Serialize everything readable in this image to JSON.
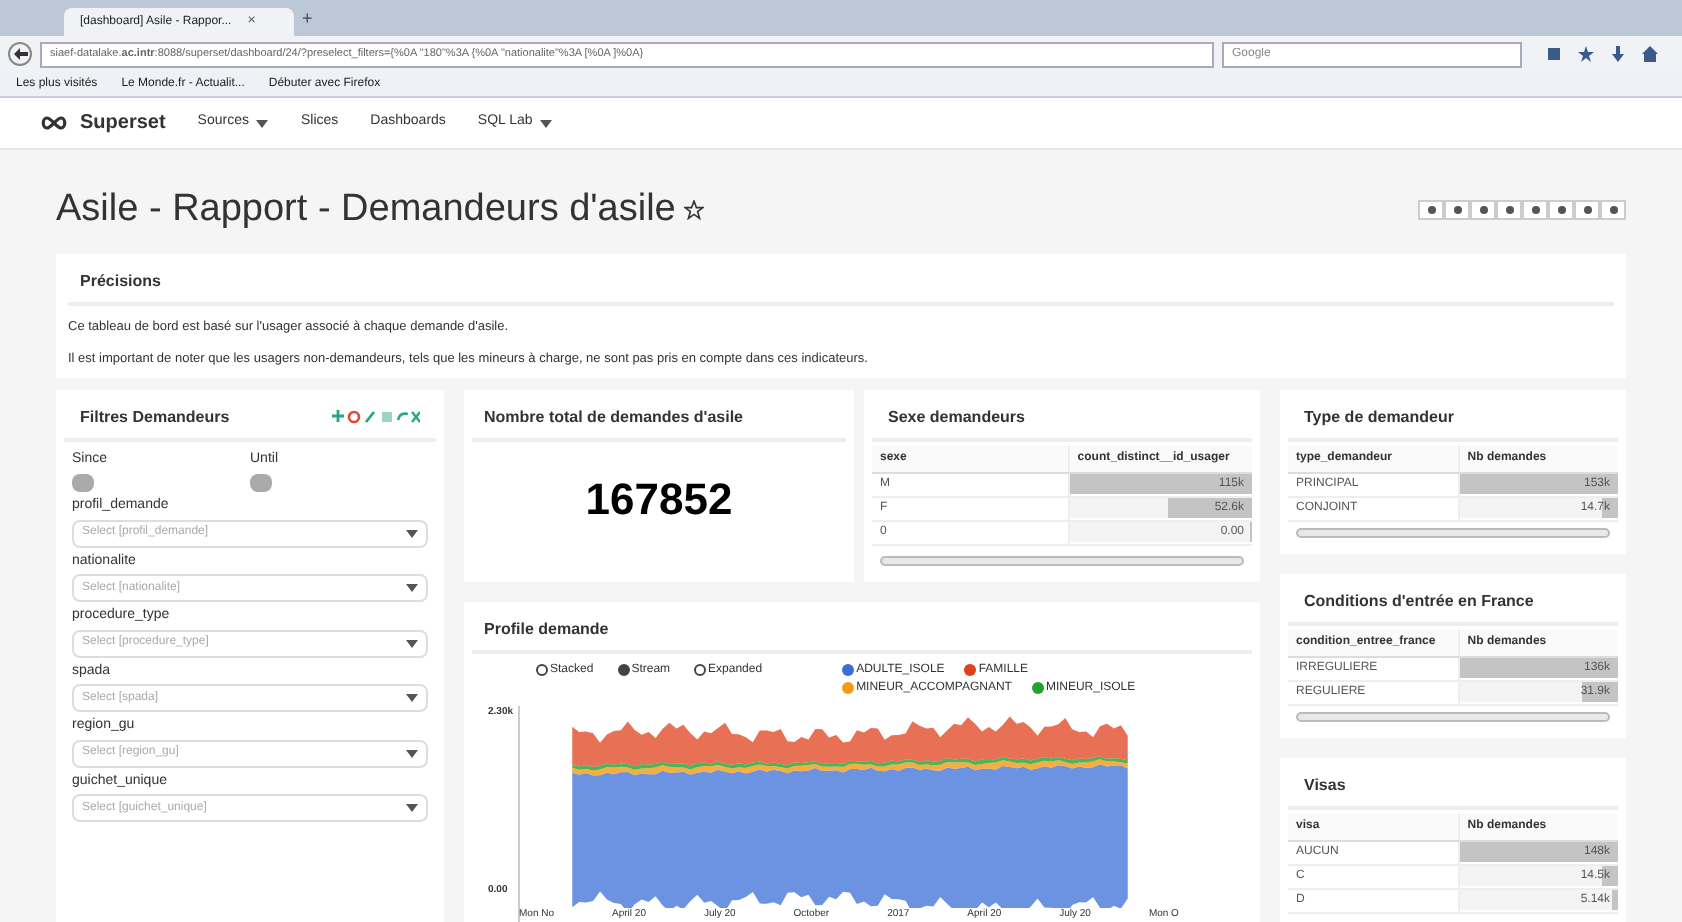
{
  "browser": {
    "tab": {
      "title": "[dashboard] Asile - Rappor...",
      "close": "×"
    },
    "new_tab": "+",
    "address": "siaef-datalake.**ac.intr**:8088/superset/dashboard/24/?preselect_filters={%0A  \"180\"%3A {%0A  \"nationalite\"%3A [%0A  ]%0A}",
    "search_placeholder": "Google",
    "bookmarks": [
      "Les plus visités",
      "Le Monde.fr - Actualit...",
      "Débuter avec Firefox"
    ]
  },
  "navbar": {
    "brand": "Superset",
    "items": [
      {
        "label": "Sources",
        "dropdown": true
      },
      {
        "label": "Slices",
        "dropdown": false
      },
      {
        "label": "Dashboards",
        "dropdown": false
      },
      {
        "label": "SQL Lab",
        "dropdown": true
      }
    ]
  },
  "dashboard": {
    "title": "Asile - Rapport - Demandeurs d'asile",
    "starred": false
  },
  "precisions": {
    "title": "Précisions",
    "lines": [
      "Ce tableau de bord est basé sur l'usager associé à chaque demande d'asile.",
      "Il est important de noter que les usagers non-demandeurs, tels que les mineurs à charge, ne sont pas pris en compte dans ces indicateurs."
    ]
  },
  "filters": {
    "title": "Filtres Demandeurs",
    "since": "Since",
    "until": "Until",
    "fields": [
      {
        "label": "profil_demande",
        "placeholder": "Select [profil_demande]"
      },
      {
        "label": "nationalite",
        "placeholder": "Select [nationalite]"
      },
      {
        "label": "procedure_type",
        "placeholder": "Select [procedure_type]"
      },
      {
        "label": "spada",
        "placeholder": "Select [spada]"
      },
      {
        "label": "region_gu",
        "placeholder": "Select [region_gu]"
      },
      {
        "label": "guichet_unique",
        "placeholder": "Select [guichet_unique]"
      }
    ]
  },
  "big_number": {
    "title": "Nombre total de demandes d'asile",
    "value": "167852"
  },
  "tables": [
    {
      "title": "Sexe demandeurs",
      "columns": [
        "sexe",
        "count_distinct__id_usager"
      ],
      "rows": [
        {
          "label": "M",
          "value": "115k",
          "level": 1
        },
        {
          "label": "F",
          "value": "52.6k",
          "level": 0.46
        },
        {
          "label": "0",
          "value": "0.00",
          "level": 0
        }
      ],
      "scrollbar": true
    },
    {
      "title": "Type de demandeur",
      "columns": [
        "type_demandeur",
        "Nb demandes"
      ],
      "rows": [
        {
          "label": "PRINCIPAL",
          "value": "153k",
          "level": 1
        },
        {
          "label": "CONJOINT",
          "value": "14.7k",
          "level": 0.1
        }
      ],
      "scrollbar": true
    },
    {
      "title": "Conditions d'entrée en France",
      "columns": [
        "condition_entree_france",
        "Nb demandes"
      ],
      "rows": [
        {
          "label": "IRREGULIERE",
          "value": "136k",
          "level": 1
        },
        {
          "label": "REGULIERE",
          "value": "31.9k",
          "level": 0.23
        }
      ],
      "scrollbar": true
    },
    {
      "title": "Visas",
      "columns": [
        "visa",
        "Nb demandes"
      ],
      "rows": [
        {
          "label": "AUCUN",
          "value": "148k",
          "level": 1
        },
        {
          "label": "C",
          "value": "14.5k",
          "level": 0.1
        },
        {
          "label": "D",
          "value": "5.14k",
          "level": 0.035
        }
      ],
      "scrollbar": false
    }
  ],
  "profile": {
    "title": "Profile demande",
    "modes": [
      {
        "label": "Stacked",
        "selected": false
      },
      {
        "label": "Stream",
        "selected": true
      },
      {
        "label": "Expanded",
        "selected": false
      }
    ],
    "legend": [
      {
        "label": "ADULTE_ISOLE",
        "color": "#3b6fd8"
      },
      {
        "label": "FAMILLE",
        "color": "#e0401c"
      },
      {
        "label": "MINEUR_ACCOMPAGNANT",
        "color": "#f59a12"
      },
      {
        "label": "MINEUR_ISOLE",
        "color": "#21a32e"
      }
    ],
    "y_labels": [
      "2.30k",
      "0.00"
    ],
    "x_labels": [
      "Mon No",
      "April 20",
      "July 20",
      "October",
      "2017",
      "April 20",
      "July 20",
      "Mon O"
    ]
  }
}
